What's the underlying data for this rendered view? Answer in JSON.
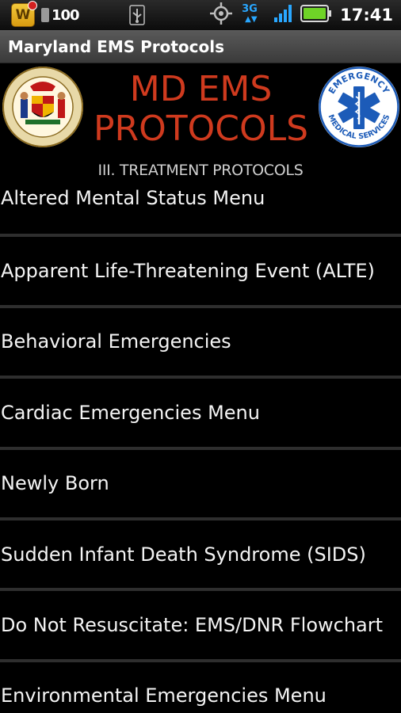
{
  "status_bar": {
    "notification_count": "100",
    "time": "17:41",
    "network": "3G",
    "app_icon_letter": "W"
  },
  "app": {
    "title": "Maryland EMS Protocols"
  },
  "header": {
    "title_line1": "MD EMS",
    "title_line2": "PROTOCOLS",
    "subtitle": "III. TREATMENT PROTOCOLS",
    "ems_logo_text": "EMERGENCY MEDICAL SERVICES"
  },
  "menu": {
    "items": [
      {
        "label": "Altered Mental Status Menu"
      },
      {
        "label": "Apparent Life-Threatening Event (ALTE)"
      },
      {
        "label": "Behavioral Emergencies"
      },
      {
        "label": "Cardiac Emergencies Menu"
      },
      {
        "label": "Newly Born"
      },
      {
        "label": "Sudden Infant Death Syndrome (SIDS)"
      },
      {
        "label": "Do Not Resuscitate: EMS/DNR Flowchart"
      },
      {
        "label": "Environmental Emergencies Menu"
      }
    ]
  },
  "colors": {
    "title_red": "#cf3a1e",
    "network_blue": "#29a7ff",
    "battery_green": "#6fd327",
    "star_of_life_blue": "#1c5bb8"
  }
}
